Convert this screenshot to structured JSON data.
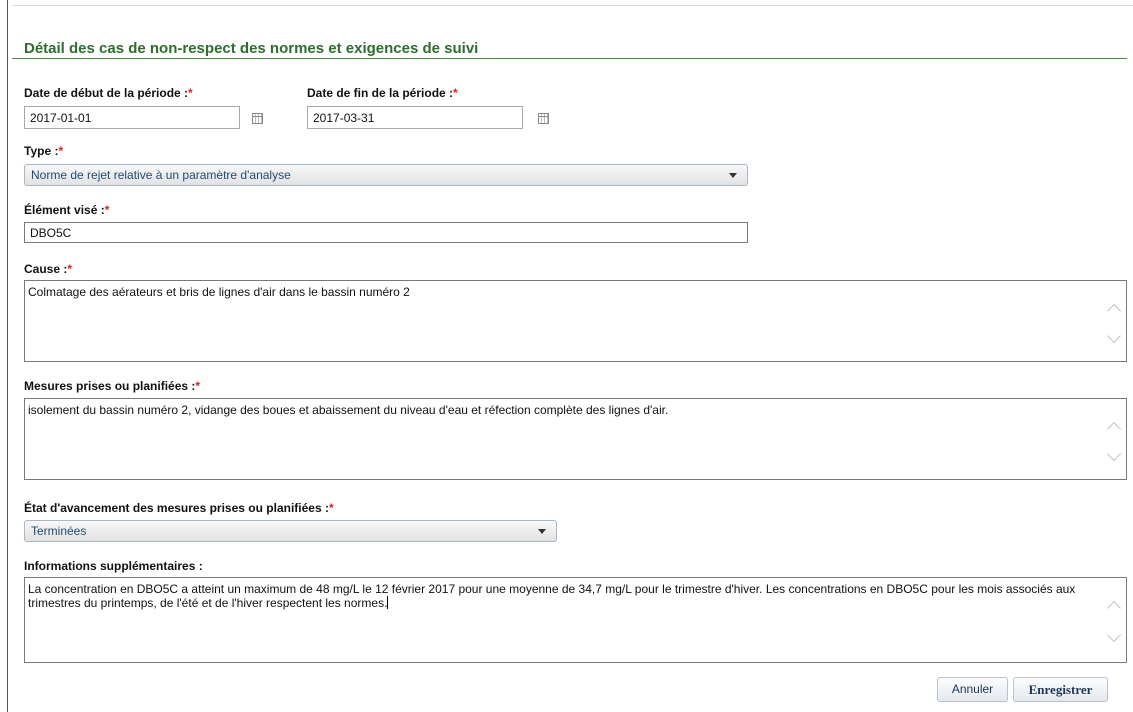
{
  "form": {
    "title": "Détail des cas de non-respect des normes et exigences de suivi",
    "required_mark": "*",
    "start_date": {
      "label": "Date de début de la période :",
      "value": "2017-01-01"
    },
    "end_date": {
      "label": "Date de fin de la période :",
      "value": "2017-03-31"
    },
    "type": {
      "label": "Type :",
      "selected": "Norme de rejet relative à un paramètre d'analyse"
    },
    "element": {
      "label": "Élément visé :",
      "value": "DBO5C"
    },
    "cause": {
      "label": "Cause :",
      "value": "Colmatage des aérateurs et bris de lignes d'air dans le bassin numéro 2"
    },
    "measures": {
      "label": "Mesures prises ou planifiées :",
      "value": "isolement du bassin numéro 2, vidange des boues et abaissement du niveau d'eau et réfection complète des lignes d'air."
    },
    "progress": {
      "label": "État d'avancement des mesures prises ou planifiées :",
      "selected": "Terminées"
    },
    "info": {
      "label": "Informations supplémentaires :",
      "value": "La concentration en DBO5C a atteint un maximum de 48 mg/L le 12 février 2017 pour une moyenne de 34,7 mg/L pour le trimestre d'hiver. Les concentrations en DBO5C pour les mois associés aux trimestres du printemps, de l'été et de l'hiver respectent les normes."
    }
  },
  "buttons": {
    "cancel": "Annuler",
    "save": "Enregistrer"
  },
  "colors": {
    "title": "#2e6e2e",
    "required": "#e02020",
    "select_text": "#1f4a7a"
  },
  "icons": {
    "date_picker": "calendar-icon",
    "dropdown": "chevron-down-icon",
    "scroll_up": "chevron-up-icon",
    "scroll_down": "chevron-down-icon"
  }
}
